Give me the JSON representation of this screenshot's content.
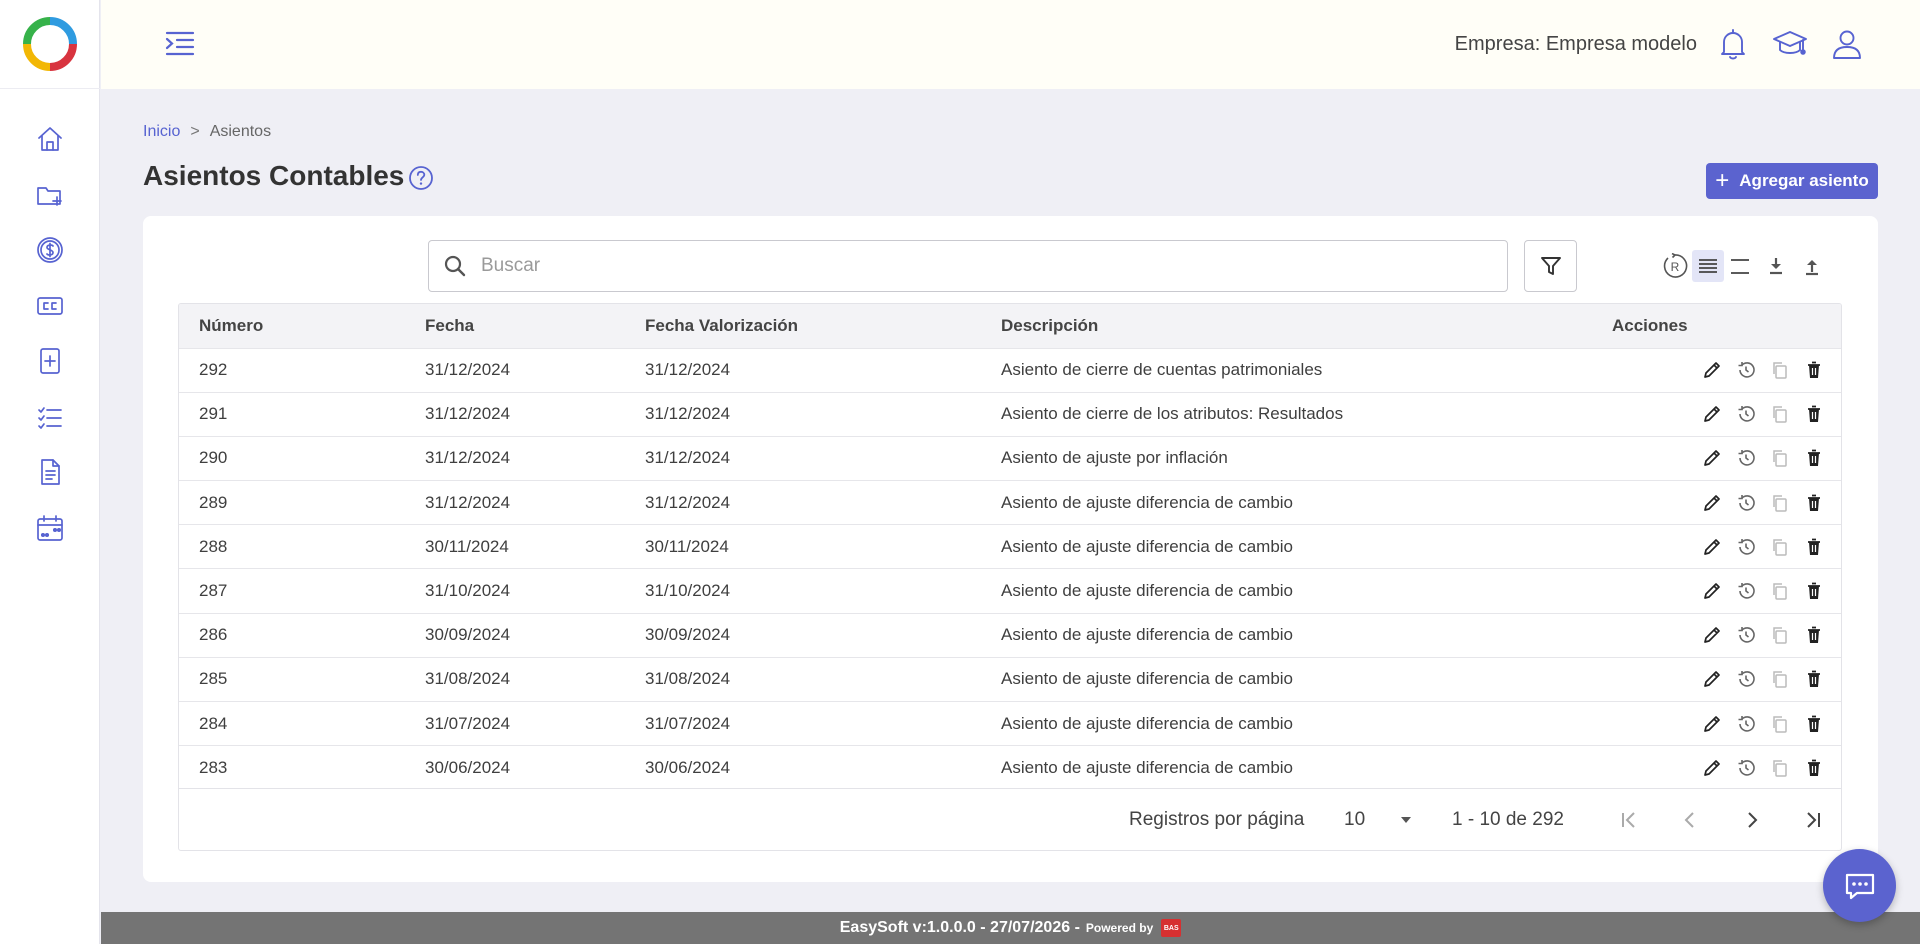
{
  "sidebar": {
    "items": [
      {
        "icon": "home-icon"
      },
      {
        "icon": "folder-add-icon"
      },
      {
        "icon": "dollar-icon"
      },
      {
        "icon": "cc-icon"
      },
      {
        "icon": "add-document-icon"
      },
      {
        "icon": "checklist-icon"
      },
      {
        "icon": "document-icon"
      },
      {
        "icon": "calendar-icon"
      }
    ]
  },
  "header": {
    "company": "Empresa: Empresa modelo"
  },
  "breadcrumb": {
    "home": "Inicio",
    "separator": ">",
    "current": "Asientos"
  },
  "page": {
    "title": "Asientos Contables",
    "add_button": "Agregar asiento"
  },
  "search": {
    "placeholder": "Buscar",
    "value": ""
  },
  "table": {
    "columns": [
      "Número",
      "Fecha",
      "Fecha Valorización",
      "Descripción",
      "Acciones"
    ],
    "rows": [
      {
        "numero": "292",
        "fecha": "31/12/2024",
        "fecha_val": "31/12/2024",
        "descripcion": "Asiento de cierre de cuentas patrimoniales"
      },
      {
        "numero": "291",
        "fecha": "31/12/2024",
        "fecha_val": "31/12/2024",
        "descripcion": "Asiento de cierre de los atributos: Resultados"
      },
      {
        "numero": "290",
        "fecha": "31/12/2024",
        "fecha_val": "31/12/2024",
        "descripcion": "Asiento de ajuste por inflación"
      },
      {
        "numero": "289",
        "fecha": "31/12/2024",
        "fecha_val": "31/12/2024",
        "descripcion": "Asiento de ajuste diferencia de cambio"
      },
      {
        "numero": "288",
        "fecha": "30/11/2024",
        "fecha_val": "30/11/2024",
        "descripcion": "Asiento de ajuste diferencia de cambio"
      },
      {
        "numero": "287",
        "fecha": "31/10/2024",
        "fecha_val": "31/10/2024",
        "descripcion": "Asiento de ajuste diferencia de cambio"
      },
      {
        "numero": "286",
        "fecha": "30/09/2024",
        "fecha_val": "30/09/2024",
        "descripcion": "Asiento de ajuste diferencia de cambio"
      },
      {
        "numero": "285",
        "fecha": "31/08/2024",
        "fecha_val": "31/08/2024",
        "descripcion": "Asiento de ajuste diferencia de cambio"
      },
      {
        "numero": "284",
        "fecha": "31/07/2024",
        "fecha_val": "31/07/2024",
        "descripcion": "Asiento de ajuste diferencia de cambio"
      },
      {
        "numero": "283",
        "fecha": "30/06/2024",
        "fecha_val": "30/06/2024",
        "descripcion": "Asiento de ajuste diferencia de cambio"
      }
    ]
  },
  "pagination": {
    "rows_per_page_label": "Registros por página",
    "rows_per_page": "10",
    "range": "1 - 10 de 292"
  },
  "footer": {
    "version": "EasySoft v:1.0.0.0 - 27/07/2026 -",
    "powered_by": "Powered by",
    "brand": "BAS"
  },
  "colors": {
    "accent": "#5763d1",
    "button": "#5b63cf",
    "header_bg": "#fffef7",
    "page_bg": "#efeff5",
    "footer_bg": "#747474"
  }
}
